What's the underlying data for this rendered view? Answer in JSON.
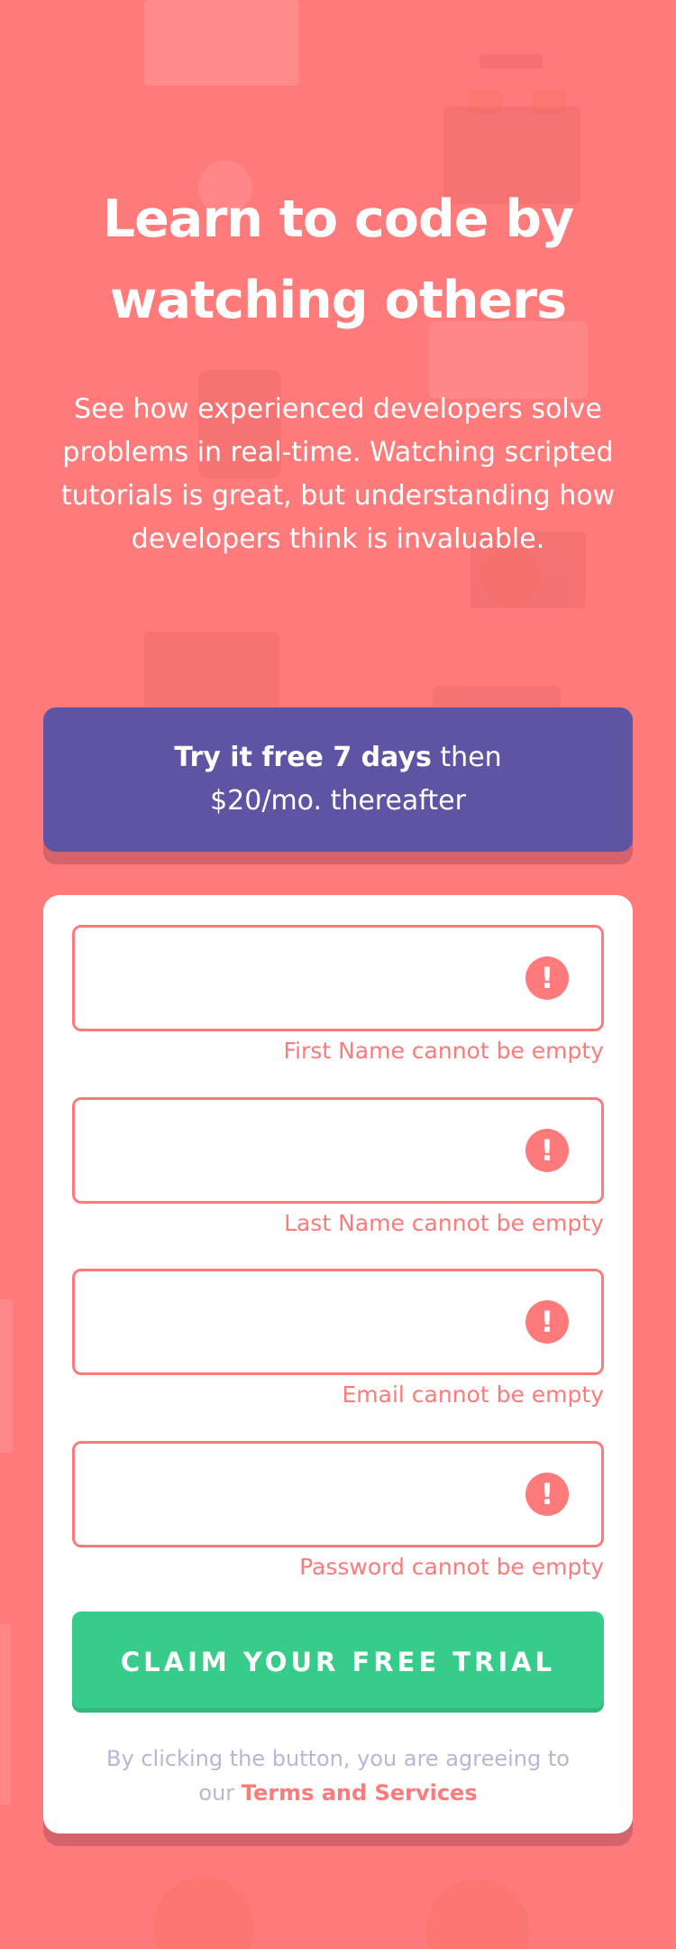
{
  "hero": {
    "title_line1": "Learn to code by",
    "title_line2": "watching others",
    "description": "See how experienced developers solve problems in real-time. Watching scripted tutorials is great, but understanding how developers think is invaluable."
  },
  "offer": {
    "strong": "Try it free 7 days",
    "rest_line1": " then",
    "line2": "$20/mo. thereafter"
  },
  "form": {
    "fields": [
      {
        "name": "first-name",
        "value": "",
        "error_icon": "!",
        "error": "First Name cannot be empty"
      },
      {
        "name": "last-name",
        "value": "",
        "error_icon": "!",
        "error": "Last Name cannot be empty"
      },
      {
        "name": "email",
        "value": "",
        "error_icon": "!",
        "error": "Email cannot be empty"
      },
      {
        "name": "password",
        "value": "",
        "error_icon": "!",
        "error": "Password cannot be empty"
      }
    ],
    "submit_label": "CLAIM YOUR FREE TRIAL",
    "terms_prefix": "By clicking the button, you are agreeing to",
    "terms_our": "our ",
    "terms_link": "Terms and Services"
  },
  "colors": {
    "background": "#ff7a7a",
    "offer_banner": "#5e54a4",
    "submit_button": "#38cc8b",
    "error": "#ff7a7a",
    "terms_text": "#b9b6d3"
  },
  "icons": [
    "exclamation-icon"
  ]
}
